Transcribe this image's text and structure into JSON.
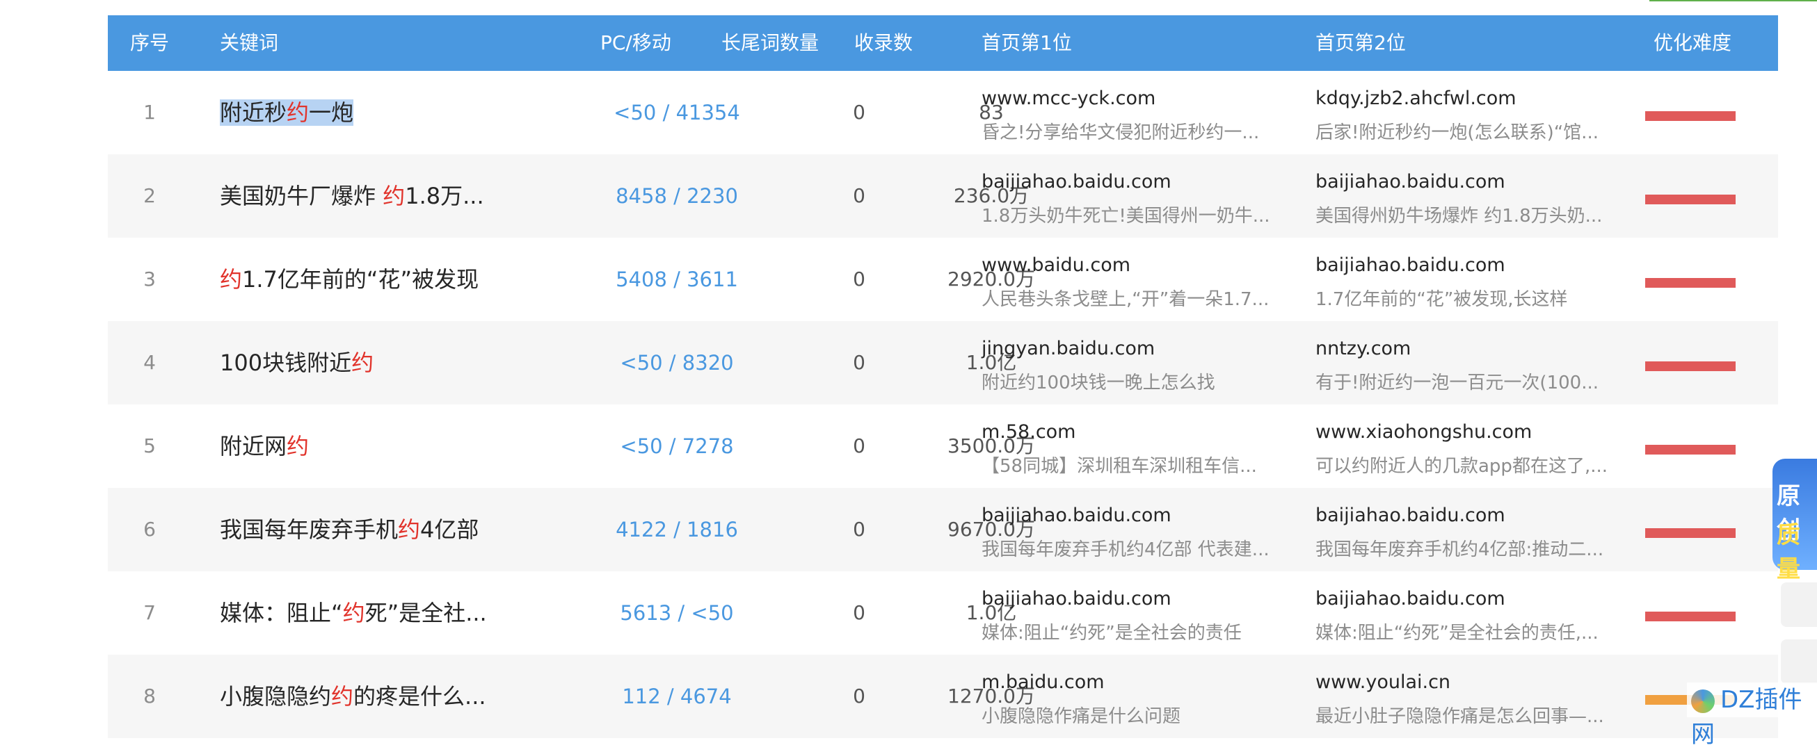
{
  "headers": {
    "index": "序号",
    "keyword": "关键词",
    "pc_mobile": "PC/移动",
    "longtail": "长尾词数量",
    "indexed": "收录数",
    "rank1": "首页第1位",
    "rank2": "首页第2位",
    "difficulty": "优化难度"
  },
  "rows": [
    {
      "idx": "1",
      "kw_pre": "附近秒",
      "kw_hl": "约",
      "kw_post": "一炮",
      "pc": "<50 / 41354",
      "tail": "0",
      "inc": "83",
      "d1": "www.mcc-yck.com",
      "s1": "昏之!分享给华文侵犯附近秒约一...",
      "d2": "kdqy.jzb2.ahcfwl.com",
      "s2": "后家!附近秒约一炮(怎么联系)“馆..."
    },
    {
      "idx": "2",
      "kw_pre": "美国奶牛厂爆炸 ",
      "kw_hl": "约",
      "kw_post": "1.8万...",
      "pc": "8458 / 2230",
      "tail": "0",
      "inc": "236.0万",
      "d1": "baijiahao.baidu.com",
      "s1": "1.8万头奶牛死亡!美国得州一奶牛...",
      "d2": "baijiahao.baidu.com",
      "s2": "美国得州奶牛场爆炸 约1.8万头奶..."
    },
    {
      "idx": "3",
      "kw_pre": "",
      "kw_hl": "约",
      "kw_post": "1.7亿年前的“花”被发现",
      "pc": "5408 / 3611",
      "tail": "0",
      "inc": "2920.0万",
      "d1": "www.baidu.com",
      "s1": "人民巷头条戈壁上,“开”着一朵1.7...",
      "d2": "baijiahao.baidu.com",
      "s2": "1.7亿年前的“花”被发现,长这样"
    },
    {
      "idx": "4",
      "kw_pre": "100块钱附近",
      "kw_hl": "约",
      "kw_post": "",
      "pc": "<50 / 8320",
      "tail": "0",
      "inc": "1.0亿",
      "d1": "jingyan.baidu.com",
      "s1": "附近约100块钱一晚上怎么找",
      "d2": "nntzy.com",
      "s2": "有于!附近约一泡一百元一次(100..."
    },
    {
      "idx": "5",
      "kw_pre": "附近网",
      "kw_hl": "约",
      "kw_post": "",
      "pc": "<50 / 7278",
      "tail": "0",
      "inc": "3500.0万",
      "d1": "m.58.com",
      "s1": "【58同城】深圳租车深圳租车信...",
      "d2": "www.xiaohongshu.com",
      "s2": "可以约附近人的几款app都在这了,..."
    },
    {
      "idx": "6",
      "kw_pre": "我国每年废弃手机",
      "kw_hl": "约",
      "kw_post": "4亿部",
      "pc": "4122 / 1816",
      "tail": "0",
      "inc": "9670.0万",
      "d1": "baijiahao.baidu.com",
      "s1": "我国每年废弃手机约4亿部 代表建...",
      "d2": "baijiahao.baidu.com",
      "s2": "我国每年废弃手机约4亿部:推动二..."
    },
    {
      "idx": "7",
      "kw_pre": "媒体：阻止“",
      "kw_hl": "约",
      "kw_post": "死”是全社...",
      "pc": "5613 / <50",
      "tail": "0",
      "inc": "1.0亿",
      "d1": "baijiahao.baidu.com",
      "s1": "媒体:阻止“约死”是全社会的责任",
      "d2": "baijiahao.baidu.com",
      "s2": "媒体:阻止“约死”是全社会的责任,..."
    },
    {
      "idx": "8",
      "kw_pre": "小腹隐隐约",
      "kw_hl": "约",
      "kw_post": "的疼是什么...",
      "pc": "112 / 4674",
      "tail": "0",
      "inc": "1270.0万",
      "d1": "m.baidu.com",
      "s1": "小腹隐隐作痛是什么问题",
      "d2": "www.youlai.cn",
      "s2": "最近小肚子隐隐作痛是怎么回事—..."
    }
  ],
  "badge": {
    "line1": "原创",
    "line2": "质量"
  },
  "watermark": "DZ插件网"
}
